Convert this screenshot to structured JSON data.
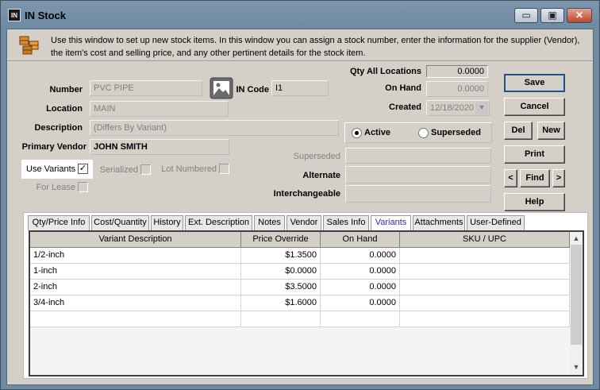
{
  "window": {
    "app_icon": "IN",
    "title": "IN Stock",
    "min_glyph": "▭",
    "max_glyph": "▣",
    "close_glyph": "✕"
  },
  "info": {
    "text": "Use this window to set up new stock items. In this window you can assign a stock number, enter the information for the supplier (Vendor), the item's cost and selling price, and any other pertinent details for the stock item."
  },
  "form": {
    "qty_all_locations_label": "Qty All Locations",
    "qty_all_locations": "0.0000",
    "on_hand_label": "On Hand",
    "on_hand": "0.0000",
    "created_label": "Created",
    "created": "12/18/2020",
    "number_label": "Number",
    "number": "PVC PIPE",
    "in_code_label": "IN Code",
    "in_code": "I1",
    "location_label": "Location",
    "location": "MAIN",
    "description_label": "Description",
    "description": "(Differs By Variant)",
    "primary_vendor_label": "Primary Vendor",
    "primary_vendor": "JOHN SMITH",
    "active_label": "Active",
    "superseded_radio_label": "Superseded",
    "superseded_label": "Superseded",
    "alternate_label": "Alternate",
    "interchangeable_label": "Interchangeable",
    "use_variants_label": "Use Variants",
    "serialized_label": "Serialized",
    "lot_numbered_label": "Lot Numbered",
    "for_lease_label": "For Lease"
  },
  "buttons": {
    "save": "Save",
    "cancel": "Cancel",
    "del": "Del",
    "new": "New",
    "print": "Print",
    "prev": "<",
    "find": "Find",
    "next": ">",
    "help": "Help"
  },
  "tabs": [
    "Qty/Price Info",
    "Cost/Quantity",
    "History",
    "Ext. Description",
    "Notes",
    "Vendor",
    "Sales Info",
    "Variants",
    "Attachments",
    "User-Defined"
  ],
  "grid": {
    "columns": [
      "Variant Description",
      "Price Override",
      "On Hand",
      "SKU / UPC"
    ],
    "rows": [
      [
        "1/2-inch",
        "$1.3500",
        "0.0000",
        ""
      ],
      [
        "1-inch",
        "$0.0000",
        "0.0000",
        ""
      ],
      [
        "2-inch",
        "$3.5000",
        "0.0000",
        ""
      ],
      [
        "3/4-inch",
        "$1.6000",
        "0.0000",
        ""
      ],
      [
        "",
        "",
        "",
        ""
      ]
    ]
  },
  "scroll": {
    "up": "▲",
    "down": "▼"
  },
  "colors": {
    "accent": "#1f4f8f",
    "active_tab_text": "#2c2ca8"
  }
}
